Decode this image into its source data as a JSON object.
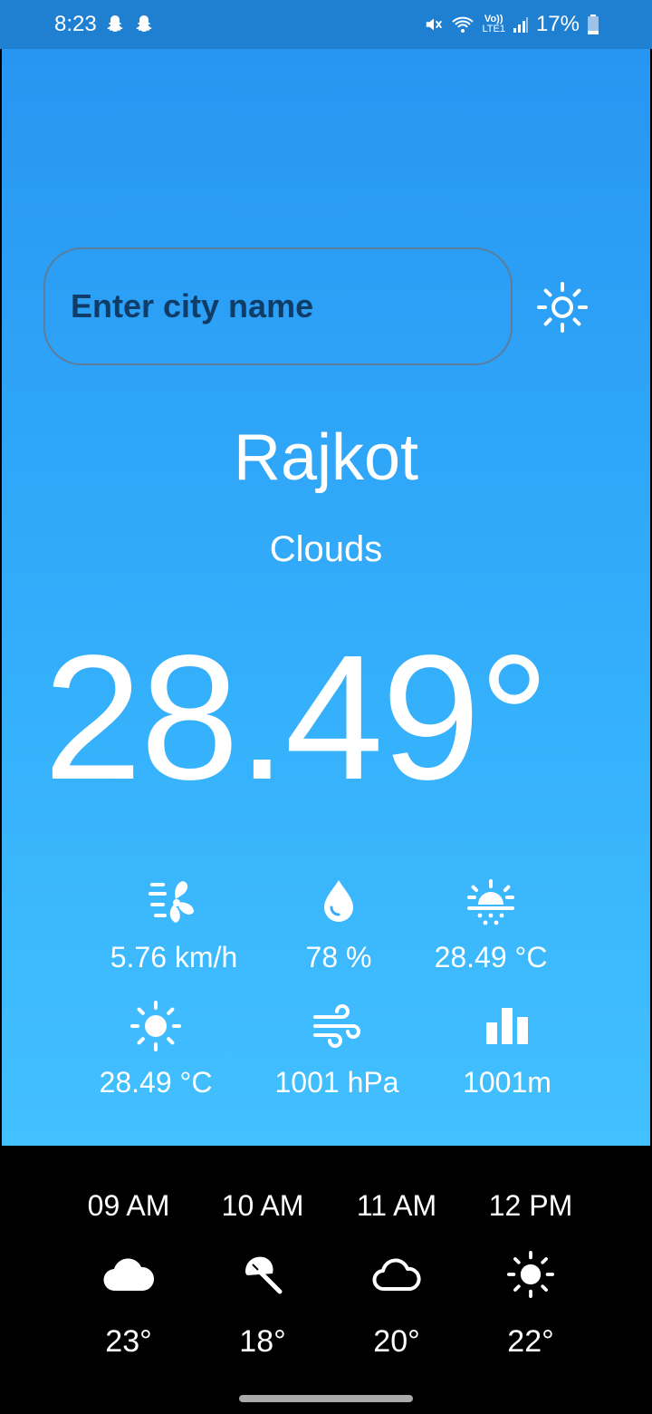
{
  "status_bar": {
    "time": "8:23",
    "network": "LTE1",
    "battery": "17%",
    "icons": [
      "snapchat-icon",
      "snapchat-icon",
      "mute-icon",
      "wifi-icon",
      "volte-icon",
      "signal-icon",
      "battery-icon"
    ]
  },
  "search": {
    "placeholder": "Enter city name",
    "theme_icon": "sun-outline-icon"
  },
  "weather": {
    "city": "Rajkot",
    "condition": "Clouds",
    "temperature": "28.49°"
  },
  "stats": [
    {
      "icon": "wind-fan-icon",
      "value": "5.76 km/h"
    },
    {
      "icon": "humidity-drop-icon",
      "value": "78 %"
    },
    {
      "icon": "sunrise-icon",
      "value": "28.49 °C"
    },
    {
      "icon": "sun-icon",
      "value": "28.49 °C"
    },
    {
      "icon": "wind-icon",
      "value": "1001 hPa"
    },
    {
      "icon": "bar-chart-icon",
      "value": "1001m"
    }
  ],
  "hourly": [
    {
      "time": "09 AM",
      "icon": "cloud-filled-icon",
      "temp": "23°"
    },
    {
      "time": "10 AM",
      "icon": "beach-umbrella-icon",
      "temp": "18°"
    },
    {
      "time": "11 AM",
      "icon": "cloud-outline-icon",
      "temp": "20°"
    },
    {
      "time": "12 PM",
      "icon": "sun-icon",
      "temp": "22°"
    }
  ],
  "colors": {
    "status_bar": "#1f7fd0",
    "gradient_top": "#2696f2",
    "gradient_bottom": "#43c0ff",
    "placeholder_text": "#103d67",
    "hourly_background": "#000000"
  }
}
